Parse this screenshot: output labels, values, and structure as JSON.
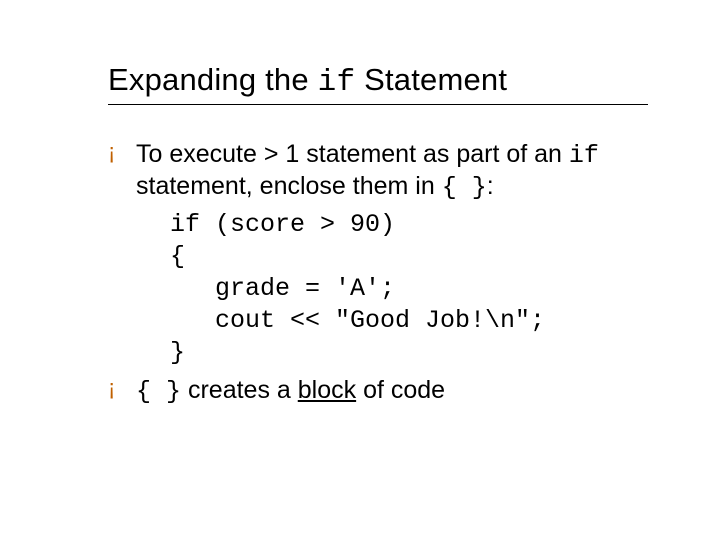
{
  "title": {
    "part1": "Expanding the ",
    "code": "if",
    "part2": " Statement"
  },
  "bullets": [
    {
      "seg1": "To execute > 1 statement as part of an ",
      "code1": "if",
      "seg2": " statement, enclose them in ",
      "code2": "{ }",
      "seg3": ":"
    },
    {
      "code1": "{ }",
      "seg1": " creates a ",
      "underline": "block",
      "seg2": " of code"
    }
  ],
  "code_example": "if (score > 90)\n{\n   grade = 'A';\n   cout << \"Good Job!\\n\";\n}"
}
